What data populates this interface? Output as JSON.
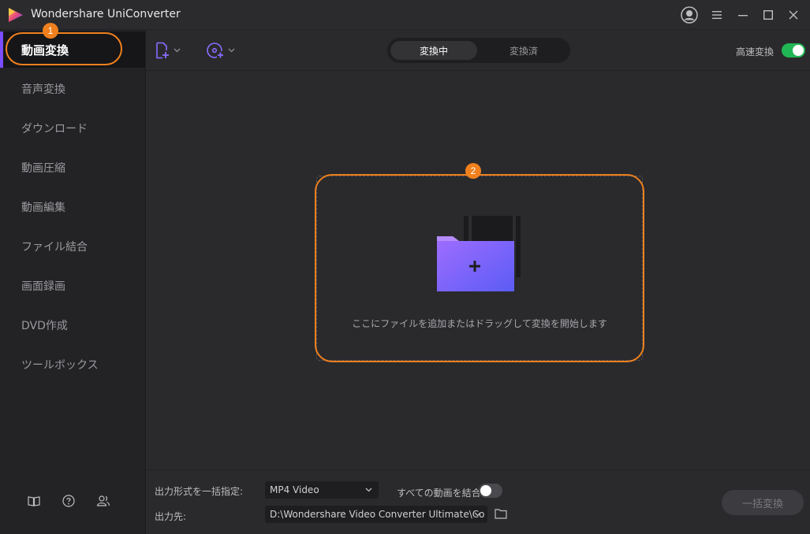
{
  "app": {
    "title": "Wondershare UniConverter"
  },
  "sidebar": {
    "items": [
      {
        "label": "動画変換",
        "active": true
      },
      {
        "label": "音声変換"
      },
      {
        "label": "ダウンロード"
      },
      {
        "label": "動画圧縮"
      },
      {
        "label": "動画編集"
      },
      {
        "label": "ファイル結合"
      },
      {
        "label": "画面録画"
      },
      {
        "label": "DVD作成"
      },
      {
        "label": "ツールボックス"
      }
    ],
    "badge": "1",
    "bottom_icons": [
      "book-icon",
      "help-icon",
      "account-switch-icon"
    ]
  },
  "toolbar": {
    "tabs": [
      {
        "label": "変換中",
        "active": true
      },
      {
        "label": "変換済"
      }
    ],
    "fast_convert_label": "高速変換",
    "fast_convert_on": true,
    "add_file_icon": "add-file-icon",
    "add_disc_icon": "add-disc-icon"
  },
  "dropzone": {
    "badge": "2",
    "text": "ここにファイルを追加またはドラッグして変換を開始します"
  },
  "footer": {
    "format_label": "出力形式を一括指定:",
    "format_value": "MP4 Video",
    "merge_label": "すべての動画を結合",
    "merge_on": false,
    "output_label": "出力先:",
    "output_value": "D:\\Wondershare Video Converter Ultimate\\Co",
    "convert_all_label": "一括変換"
  },
  "colors": {
    "accent": "#7a4dff",
    "highlight": "#f0801d",
    "toggle_on": "#21b655"
  }
}
